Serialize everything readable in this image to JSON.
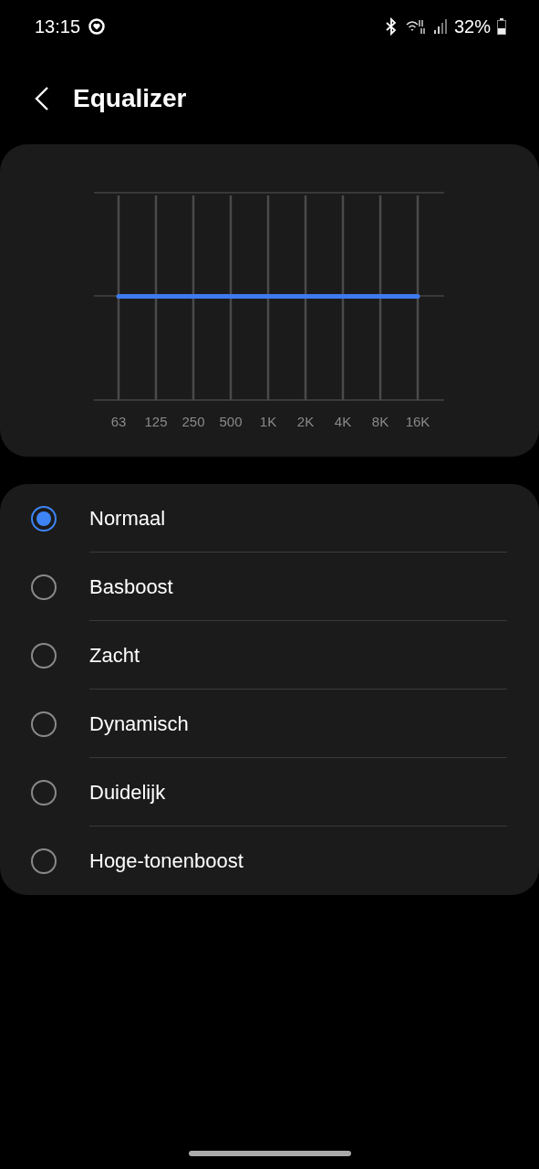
{
  "status_bar": {
    "time": "13:15",
    "battery": "32%"
  },
  "header": {
    "title": "Equalizer"
  },
  "equalizer": {
    "bands": [
      "63",
      "125",
      "250",
      "500",
      "1K",
      "2K",
      "4K",
      "8K",
      "16K"
    ]
  },
  "presets": [
    {
      "label": "Normaal",
      "selected": true
    },
    {
      "label": "Basboost",
      "selected": false
    },
    {
      "label": "Zacht",
      "selected": false
    },
    {
      "label": "Dynamisch",
      "selected": false
    },
    {
      "label": "Duidelijk",
      "selected": false
    },
    {
      "label": "Hoge-tonenboost",
      "selected": false
    }
  ]
}
